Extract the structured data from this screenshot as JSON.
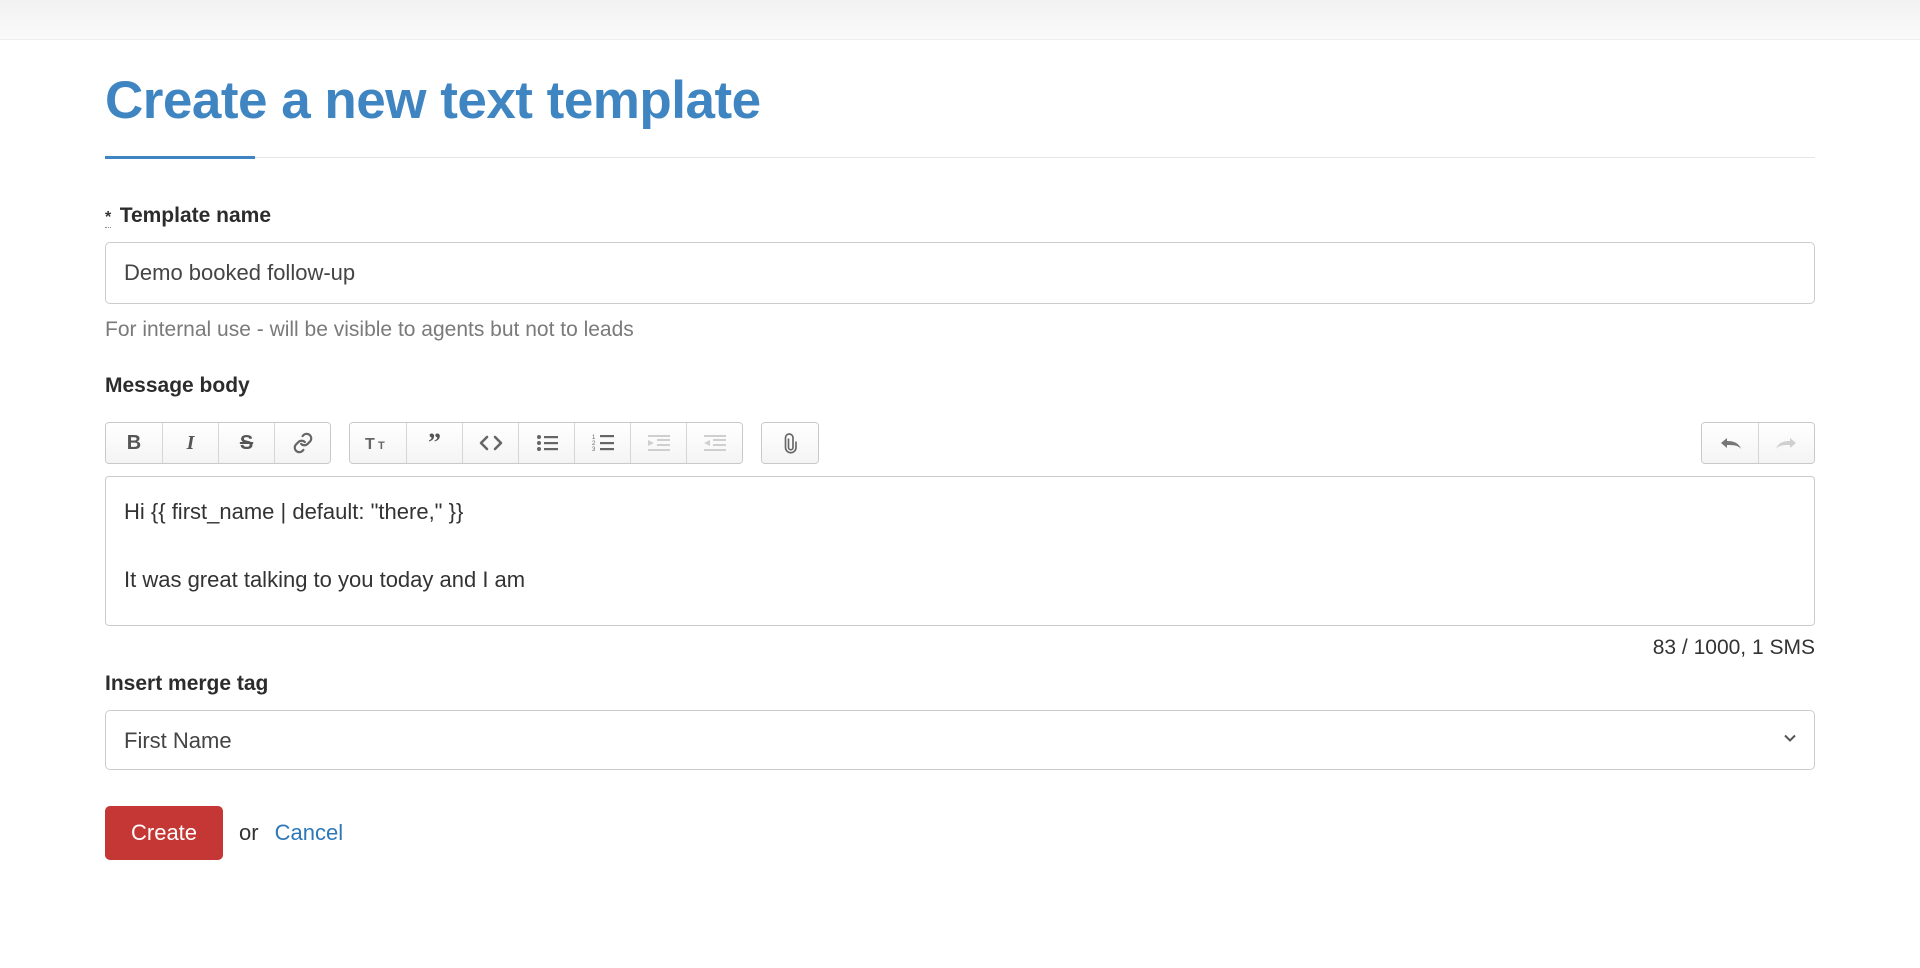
{
  "page": {
    "title": "Create a new text template"
  },
  "template_name": {
    "label": "Template name",
    "required_mark": "*",
    "value": "Demo booked follow-up",
    "help": "For internal use - will be visible to agents but not to leads"
  },
  "message_body": {
    "label": "Message body",
    "content": "Hi {{ first_name | default: \"there,\" }}\n\nIt was great talking to you today and I am",
    "counter": "83 / 1000, 1 SMS"
  },
  "merge_tag": {
    "label": "Insert merge tag",
    "selected": "First Name"
  },
  "actions": {
    "create": "Create",
    "or": "or",
    "cancel": "Cancel"
  },
  "toolbar": {
    "bold": "B",
    "italic": "I",
    "strike": "S",
    "link": "link",
    "heading": "T",
    "quote": "”",
    "code": "<>",
    "ul": "ul",
    "ol": "ol",
    "outdent": "outdent",
    "indent": "indent",
    "attach": "attach",
    "undo": "undo",
    "redo": "redo"
  }
}
